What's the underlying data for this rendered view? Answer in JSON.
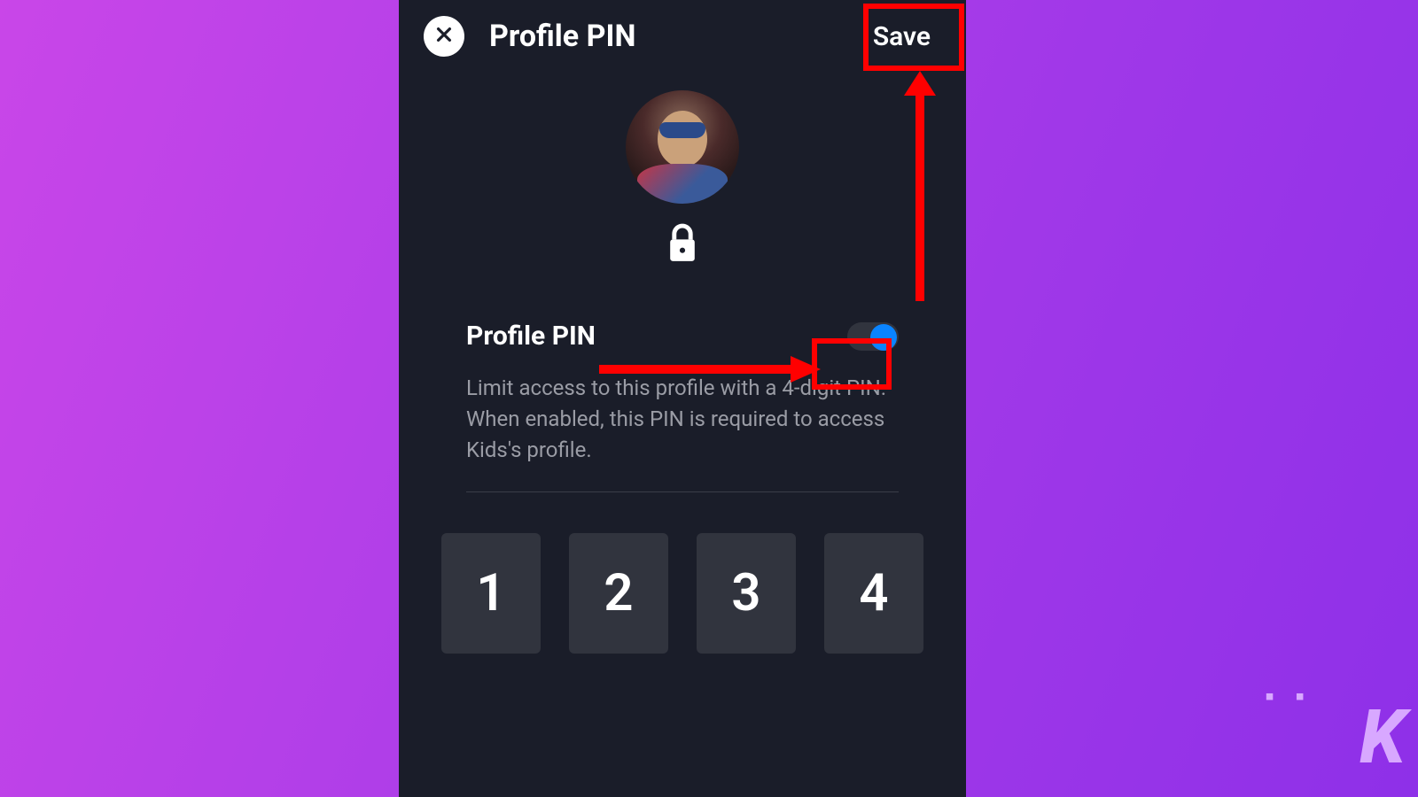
{
  "header": {
    "title": "Profile PIN",
    "save_label": "Save"
  },
  "section": {
    "title": "Profile PIN",
    "description": "Limit access to this profile with a 4-digit PIN. When enabled, this PIN is required to access Kids's profile."
  },
  "toggle": {
    "state": "on"
  },
  "pin": {
    "digits": [
      "1",
      "2",
      "3",
      "4"
    ]
  },
  "watermark": {
    "letter": "K"
  }
}
